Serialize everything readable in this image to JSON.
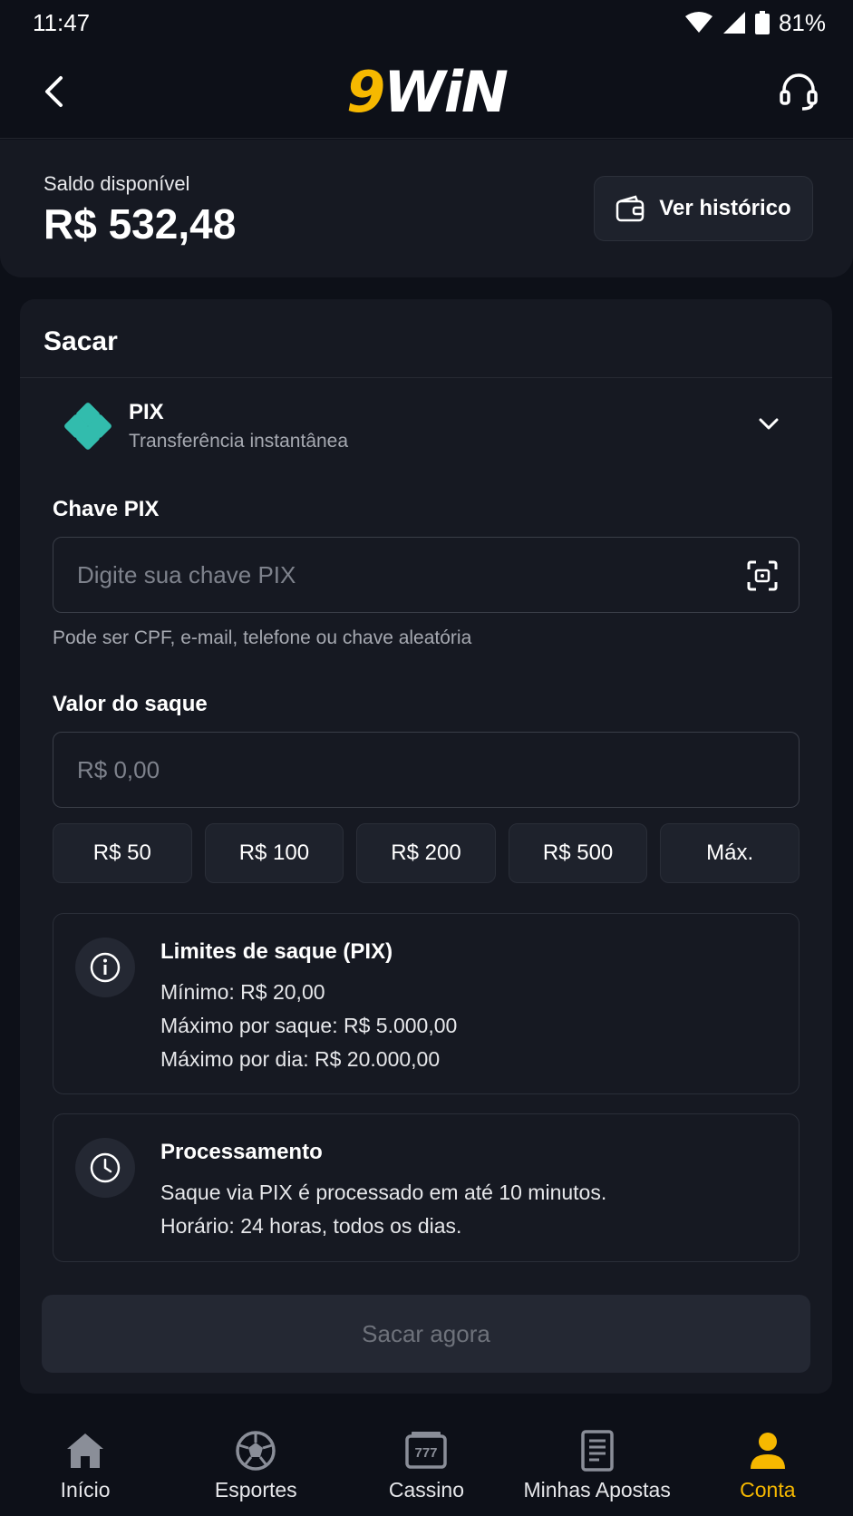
{
  "status": {
    "time": "11:47",
    "battery": "81%"
  },
  "header": {
    "logo_nine": "9",
    "logo_win": "WiN"
  },
  "balance": {
    "label": "Saldo disponível",
    "value": "R$ 532,48",
    "history_label": "Ver histórico"
  },
  "withdraw": {
    "title": "Sacar",
    "method": {
      "name": "PIX",
      "description": "Transferência instantânea"
    },
    "pix_key": {
      "label": "Chave PIX",
      "placeholder": "Digite sua chave PIX",
      "hint": "Pode ser CPF, e-mail, telefone ou chave aleatória"
    },
    "amount": {
      "label": "Valor do saque",
      "placeholder": "R$ 0,00",
      "chips": [
        "R$ 50",
        "R$ 100",
        "R$ 200",
        "R$ 500",
        "Máx."
      ]
    },
    "limits": {
      "title": "Limites de saque (PIX)",
      "lines": [
        "Mínimo: R$ 20,00",
        "Máximo por saque: R$ 5.000,00",
        "Máximo por dia: R$ 20.000,00"
      ]
    },
    "processing": {
      "title": "Processamento",
      "lines": [
        "Saque via PIX é processado em até 10 minutos.",
        "Horário: 24 horas, todos os dias."
      ]
    },
    "submit_label": "Sacar agora"
  },
  "nav": [
    {
      "label": "Início",
      "icon": "home-icon"
    },
    {
      "label": "Esportes",
      "icon": "soccer-ball-icon"
    },
    {
      "label": "Cassino",
      "icon": "slot-machine-icon"
    },
    {
      "label": "Minhas Apostas",
      "icon": "bet-slip-icon"
    },
    {
      "label": "Conta",
      "icon": "user-icon"
    }
  ],
  "colors": {
    "accent": "#f6b800",
    "pix": "#32bcad",
    "background": "#0d1018",
    "card": "#161922"
  }
}
